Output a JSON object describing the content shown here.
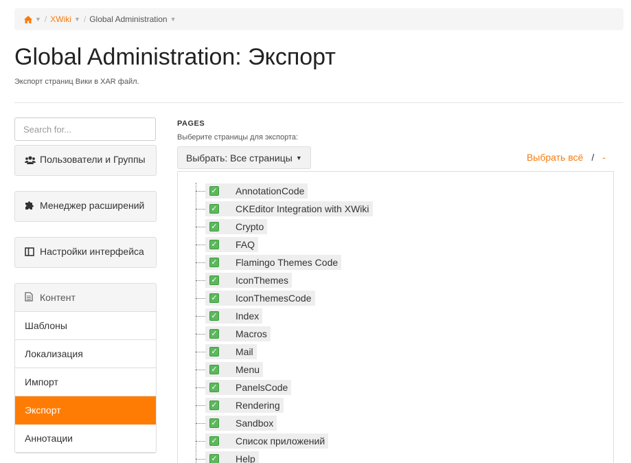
{
  "breadcrumb": {
    "home_icon": "home-icon",
    "caret": "▼",
    "separator": "/",
    "items": [
      "XWiki",
      "Global Administration"
    ]
  },
  "header": {
    "title": "Global Administration: Экспорт",
    "subtitle": "Экспорт страниц Вики в XAR файл."
  },
  "sidebar": {
    "search_placeholder": "Search for...",
    "categories": [
      {
        "label": "Пользователи и Группы",
        "icon": "users-icon"
      },
      {
        "label": "Менеджер расширений",
        "icon": "puzzle-icon"
      },
      {
        "label": "Настройки интерфейса",
        "icon": "layout-icon"
      }
    ],
    "content_group": {
      "label": "Контент",
      "icon": "document-icon",
      "items": [
        "Шаблоны",
        "Локализация",
        "Импорт",
        "Экспорт",
        "Аннотации"
      ],
      "active": "Экспорт"
    }
  },
  "main": {
    "section_title": "PAGES",
    "hint": "Выберите страницы для экспорта:",
    "select_button": "Выбрать: Все страницы",
    "select_all": "Выбрать всё",
    "link_separator": "/",
    "select_none": "-",
    "pages": [
      "AnnotationCode",
      "CKEditor Integration with XWiki",
      "Crypto",
      "FAQ",
      "Flamingo Themes Code",
      "IconThemes",
      "IconThemesCode",
      "Index",
      "Macros",
      "Mail",
      "Menu",
      "PanelsCode",
      "Rendering",
      "Sandbox",
      "Список приложений",
      "Help"
    ]
  },
  "colors": {
    "accent": "#f77b0f",
    "active_item": "#ff7c04",
    "check": "#5cb85c"
  }
}
